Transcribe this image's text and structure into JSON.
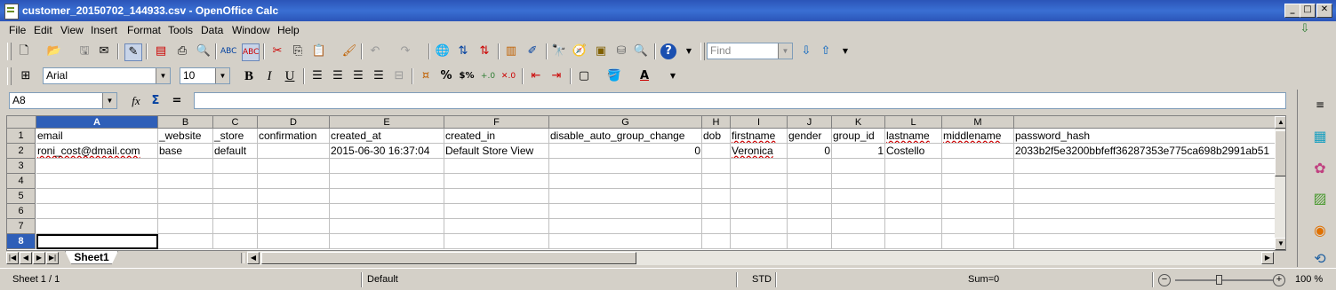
{
  "window": {
    "title": "customer_20150702_144933.csv - OpenOffice Calc",
    "buttons": {
      "minimize": "_",
      "maximize": "□",
      "close": "✕"
    }
  },
  "menu": [
    "File",
    "Edit",
    "View",
    "Insert",
    "Format",
    "Tools",
    "Data",
    "Window",
    "Help"
  ],
  "toolbar": {
    "find_placeholder": "Find",
    "font_name": "Arial",
    "font_size": "10",
    "bold": "B",
    "italic": "I",
    "underline": "U"
  },
  "formula_bar": {
    "name_box": "A8",
    "function_wizard": "fx",
    "sum": "Σ",
    "equals": "=",
    "content": ""
  },
  "sheet": {
    "columns": [
      "A",
      "B",
      "C",
      "D",
      "E",
      "F",
      "G",
      "H",
      "I",
      "J",
      "K",
      "L",
      "M",
      ""
    ],
    "selected_column": "A",
    "rows": [
      "1",
      "2",
      "3",
      "4",
      "5",
      "6",
      "7",
      "8"
    ],
    "selected_row": "8",
    "cells": [
      [
        "email",
        "_website",
        "_store",
        "confirmation",
        "created_at",
        "created_in",
        "disable_auto_group_change",
        "dob",
        "firstname",
        "gender",
        "group_id",
        "lastname",
        "middlename",
        "password_hash"
      ],
      [
        "roni_cost@dmail.com",
        "base",
        "default",
        "",
        "2015-06-30 16:37:04",
        "Default Store View",
        "0",
        "",
        "Veronica",
        "0",
        "1",
        "Costello",
        "",
        "2033b2f5e3200bbfeff36287353e775ca698b2991ab51"
      ]
    ],
    "tab": "Sheet1"
  },
  "status": {
    "sheet": "Sheet 1 / 1",
    "style": "Default",
    "mode": "STD",
    "sum": "Sum=0",
    "zoom": "100 %"
  }
}
